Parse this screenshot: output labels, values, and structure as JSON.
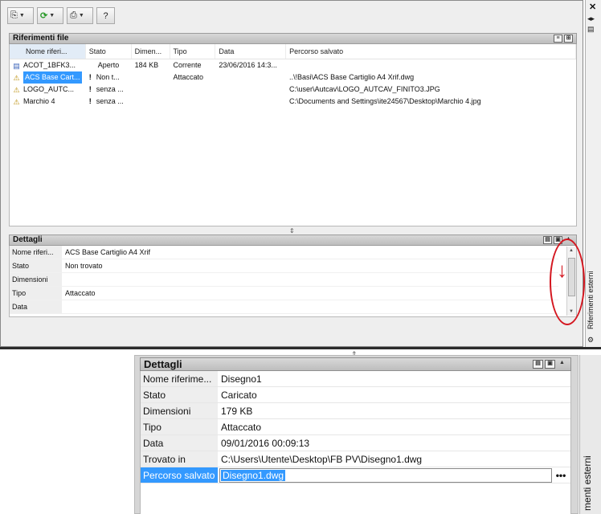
{
  "palette": {
    "section_title": "Riferimenti file",
    "columns": [
      "Nome riferi...",
      "Stato",
      "Dimen...",
      "Tipo",
      "Data",
      "Percorso salvato"
    ],
    "rows": [
      {
        "name": "ACOT_1BFK3...",
        "status": "Aperto",
        "size": "184 KB",
        "type": "Corrente",
        "date": "23/06/2016 14:3...",
        "path": "",
        "warn": false
      },
      {
        "name": "ACS Base Cart...",
        "status": "Non t...",
        "size": "",
        "type": "Attaccato",
        "date": "",
        "path": "..\\!Basi\\ACS Base Cartiglio A4 Xrif.dwg",
        "warn": true
      },
      {
        "name": "LOGO_AUTC...",
        "status": "senza ...",
        "size": "",
        "type": "",
        "date": "",
        "path": "C:\\user\\Autcav\\LOGO_AUTCAV_FINITO3.JPG",
        "warn": true
      },
      {
        "name": "Marchio 4",
        "status": "senza ...",
        "size": "",
        "type": "",
        "date": "",
        "path": "C:\\Documents and Settings\\ite24567\\Desktop\\Marchio 4.jpg",
        "warn": true
      }
    ],
    "warn_glyph": "!",
    "details_title": "Dettagli",
    "details": [
      {
        "k": "Nome riferi...",
        "v": "ACS Base Cartiglio A4 Xrif"
      },
      {
        "k": "Stato",
        "v": "Non trovato"
      },
      {
        "k": "Dimensioni",
        "v": ""
      },
      {
        "k": "Tipo",
        "v": "Attaccato"
      },
      {
        "k": "Data",
        "v": ""
      }
    ],
    "side_tab_label": "Riferimenti esterni",
    "close_glyph": "✕",
    "annotation_color": "#d4161f"
  },
  "zoom": {
    "details_title": "Dettagli",
    "details": [
      {
        "k": "Nome riferime...",
        "v": "Disegno1"
      },
      {
        "k": "Stato",
        "v": "Caricato"
      },
      {
        "k": "Dimensioni",
        "v": "179 KB"
      },
      {
        "k": "Tipo",
        "v": "Attaccato"
      },
      {
        "k": "Data",
        "v": "09/01/2016 00:09:13"
      },
      {
        "k": "Trovato in",
        "v": "C:\\Users\\Utente\\Desktop\\FB PV\\Disegno1.dwg"
      }
    ],
    "edit_row": {
      "k": "Percorso salvato",
      "v": "Disegno1.dwg",
      "button": "•••"
    },
    "side_tab_label": "menti esterni"
  },
  "colors": {
    "selection": "#3399ff",
    "header_gray": "#bdbdbd"
  }
}
